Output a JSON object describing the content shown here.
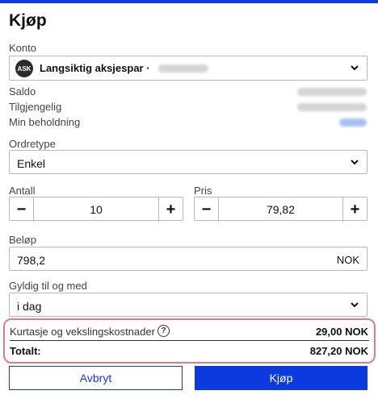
{
  "header": {
    "title": "Kjøp"
  },
  "account": {
    "label": "Konto",
    "avatar": "ASK",
    "name": "Langsiktig aksjespar ·",
    "chevron_icon": "chevron-down-icon"
  },
  "info": {
    "saldo_label": "Saldo",
    "available_label": "Tilgjengelig",
    "holding_label": "Min beholdning"
  },
  "order_type": {
    "label": "Ordretype",
    "value": "Enkel"
  },
  "quantity": {
    "label": "Antall",
    "value": "10",
    "minus": "−",
    "plus": "+"
  },
  "price": {
    "label": "Pris",
    "value": "79,82",
    "minus": "−",
    "plus": "+"
  },
  "amount": {
    "label": "Beløp",
    "value": "798,2",
    "currency": "NOK"
  },
  "validity": {
    "label": "Gyldig til og med",
    "value": "i dag"
  },
  "fees": {
    "label": "Kurtasje og vekslingskostnader",
    "help_icon": "?",
    "value": "29,00 NOK",
    "total_label": "Totalt:",
    "total_value": "827,20 NOK"
  },
  "actions": {
    "cancel": "Avbryt",
    "buy": "Kjøp"
  },
  "colors": {
    "accent": "#0b3be0",
    "highlight": "#e07b8d"
  }
}
